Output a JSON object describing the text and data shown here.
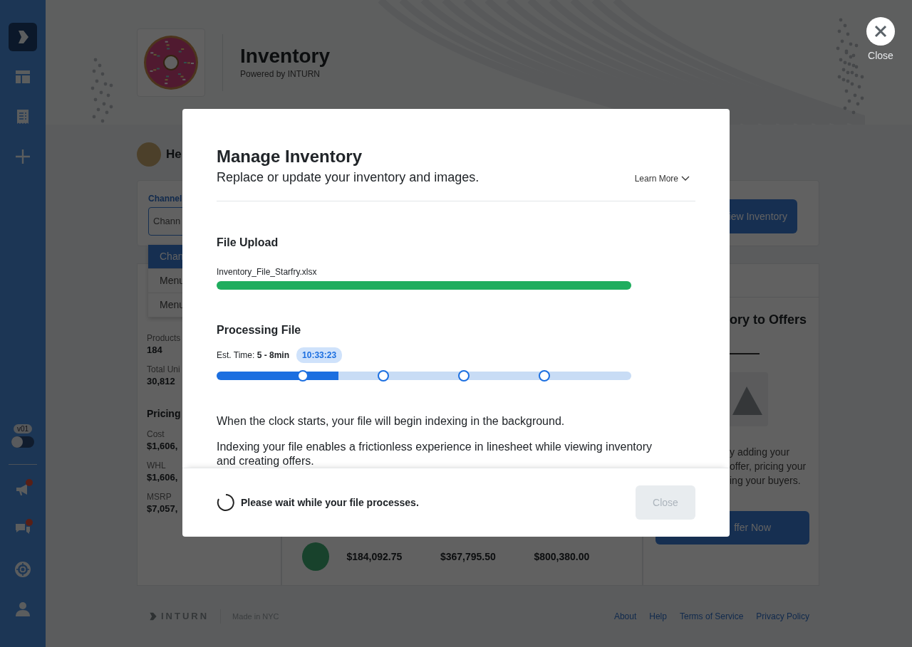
{
  "sidebar": {
    "items": [
      {
        "kind": "logo",
        "selected": true,
        "alert": false
      },
      {
        "kind": "layout",
        "selected": false,
        "alert": false
      },
      {
        "kind": "receipt",
        "selected": false,
        "alert": false
      },
      {
        "kind": "add",
        "selected": false,
        "alert": false
      }
    ],
    "version": "v01",
    "toggle_on": false,
    "bottom_items": [
      {
        "kind": "megaphone",
        "selected": false,
        "alert": true
      },
      {
        "kind": "chat",
        "selected": false,
        "alert": true
      },
      {
        "kind": "lifebuoy",
        "selected": false,
        "alert": false
      },
      {
        "kind": "user",
        "selected": false,
        "alert": false
      }
    ]
  },
  "header": {
    "title": "Inventory",
    "subtitle": "Powered by INTURN"
  },
  "close_button": {
    "label": "Close"
  },
  "greeting": "He",
  "channel_filter": {
    "label": "Channel",
    "value": "Chann",
    "options": [
      {
        "label": "Chan",
        "selected": true
      },
      {
        "label": "Menu",
        "selected": false
      },
      {
        "label": "Menu",
        "selected": false
      }
    ]
  },
  "quantity": [
    {
      "label": "Products",
      "value": "184"
    },
    {
      "label": "Total Uni",
      "value": "30,812"
    }
  ],
  "pricing": {
    "title": "Pricing",
    "items": [
      {
        "label": "Cost",
        "value": "$1,606,"
      },
      {
        "label": "WHL",
        "value": "$1,606,"
      },
      {
        "label": "MSRP",
        "value": "$7,057,"
      }
    ]
  },
  "view_inventory_button": "iew Inventory",
  "totals": [
    "$184,092.75",
    "$367,795.50",
    "$800,380.00"
  ],
  "offers_card": {
    "title": "ory to Offers",
    "text": "y adding your\noffer, pricing your\ning your buyers.",
    "button": "ffer Now"
  },
  "footer": {
    "brand": "INTURN",
    "made_in": "Made in NYC",
    "links": [
      "About",
      "Help",
      "Terms of Service",
      "Privacy Policy"
    ]
  },
  "modal": {
    "title": "Manage Inventory",
    "subtitle": "Replace or update your inventory and images.",
    "learn_more": "Learn More",
    "upload": {
      "title": "File Upload",
      "file_name": "Inventory_File_Starfry.xlsx",
      "level": 1
    },
    "processing": {
      "title": "Processing File",
      "estimate": "Est. Time: **5 - 8min**",
      "timer": "10:33:23",
      "level": 0.294
    },
    "paragraphs": [
      "When the clock starts, your file will begin indexing in the background.",
      "Indexing your file enables a frictionless experience in linesheet while viewing inventory and creating offers."
    ],
    "status": "Please wait while your file processes.",
    "close_button": {
      "label": "Close",
      "disabled": true
    }
  }
}
